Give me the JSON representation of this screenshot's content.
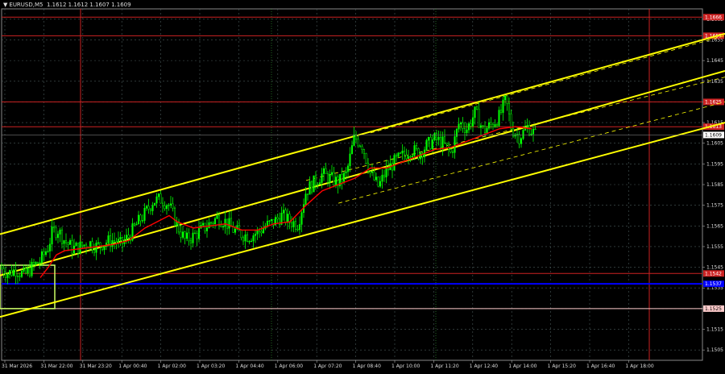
{
  "header": {
    "symbol": "EURUSD,M5",
    "ohlc": "1.1612 1.1612 1.1607 1.1609"
  },
  "chart_data": {
    "type": "candlestick",
    "symbol": "EURUSD",
    "timeframe": "M5",
    "ylim": [
      1.15,
      1.167
    ],
    "y_ticks": [
      "1.1665",
      "1.1655",
      "1.1645",
      "1.1635",
      "1.1625",
      "1.1615",
      "1.1605",
      "1.1595",
      "1.1585",
      "1.1575",
      "1.1565",
      "1.1555",
      "1.1545",
      "1.1535",
      "1.1525",
      "1.1515",
      "1.1505"
    ],
    "x_ticks": [
      "31 Mar 2026",
      "31 Mar 22:00",
      "31 Mar 23:20",
      "1 Apr 00:40",
      "1 Apr 02:00",
      "1 Apr 03:20",
      "1 Apr 04:40",
      "1 Apr 06:00",
      "1 Apr 07:20",
      "1 Apr 08:40",
      "1 Apr 10:00",
      "1 Apr 11:20",
      "1 Apr 12:40",
      "1 Apr 14:00",
      "1 Apr 15:20",
      "1 Apr 16:40",
      "1 Apr 18:00"
    ],
    "price_series": [
      [
        0,
        1.1545
      ],
      [
        10,
        1.1542
      ],
      [
        20,
        1.1544
      ],
      [
        30,
        1.1541
      ],
      [
        40,
        1.1545
      ],
      [
        50,
        1.1548
      ],
      [
        60,
        1.1555
      ],
      [
        65,
        1.1562
      ],
      [
        72,
        1.1563
      ],
      [
        80,
        1.1558
      ],
      [
        90,
        1.1554
      ],
      [
        100,
        1.1555
      ],
      [
        110,
        1.1557
      ],
      [
        120,
        1.1555
      ],
      [
        130,
        1.1557
      ],
      [
        140,
        1.1558
      ],
      [
        150,
        1.1556
      ],
      [
        160,
        1.156
      ],
      [
        170,
        1.1566
      ],
      [
        180,
        1.1571
      ],
      [
        190,
        1.1577
      ],
      [
        200,
        1.1578
      ],
      [
        210,
        1.1575
      ],
      [
        220,
        1.1565
      ],
      [
        230,
        1.1558
      ],
      [
        240,
        1.156
      ],
      [
        250,
        1.1563
      ],
      [
        260,
        1.1566
      ],
      [
        270,
        1.1569
      ],
      [
        280,
        1.1567
      ],
      [
        290,
        1.1563
      ],
      [
        300,
        1.1561
      ],
      [
        310,
        1.156
      ],
      [
        320,
        1.1562
      ],
      [
        330,
        1.1565
      ],
      [
        340,
        1.1567
      ],
      [
        350,
        1.157
      ],
      [
        360,
        1.1567
      ],
      [
        370,
        1.1566
      ],
      [
        380,
        1.1582
      ],
      [
        390,
        1.1586
      ],
      [
        400,
        1.159
      ],
      [
        410,
        1.1588
      ],
      [
        420,
        1.1586
      ],
      [
        430,
        1.159
      ],
      [
        440,
        1.1608
      ],
      [
        450,
        1.1604
      ],
      [
        460,
        1.159
      ],
      [
        470,
        1.1584
      ],
      [
        480,
        1.1592
      ],
      [
        490,
        1.1596
      ],
      [
        500,
        1.1599
      ],
      [
        510,
        1.1602
      ],
      [
        520,
        1.16
      ],
      [
        530,
        1.1604
      ],
      [
        540,
        1.1607
      ],
      [
        550,
        1.1605
      ],
      [
        560,
        1.16
      ],
      [
        570,
        1.1615
      ],
      [
        580,
        1.1612
      ],
      [
        590,
        1.162
      ],
      [
        600,
        1.1611
      ],
      [
        610,
        1.1614
      ],
      [
        620,
        1.1618
      ],
      [
        628,
        1.1626
      ],
      [
        635,
        1.1612
      ],
      [
        645,
        1.1608
      ],
      [
        655,
        1.1613
      ],
      [
        665,
        1.1609
      ]
    ],
    "ma_series": [
      [
        50,
        1.154
      ],
      [
        60,
        1.1545
      ],
      [
        70,
        1.1551
      ],
      [
        80,
        1.1553
      ],
      [
        100,
        1.1554
      ],
      [
        120,
        1.1555
      ],
      [
        140,
        1.1556
      ],
      [
        160,
        1.1558
      ],
      [
        180,
        1.1564
      ],
      [
        200,
        1.1568
      ],
      [
        210,
        1.157
      ],
      [
        220,
        1.1567
      ],
      [
        240,
        1.1564
      ],
      [
        260,
        1.1565
      ],
      [
        280,
        1.1566
      ],
      [
        300,
        1.1563
      ],
      [
        320,
        1.1563
      ],
      [
        340,
        1.1566
      ],
      [
        360,
        1.1567
      ],
      [
        380,
        1.1575
      ],
      [
        400,
        1.1582
      ],
      [
        420,
        1.1585
      ],
      [
        440,
        1.1588
      ],
      [
        460,
        1.1593
      ],
      [
        480,
        1.1593
      ],
      [
        500,
        1.1596
      ],
      [
        520,
        1.1599
      ],
      [
        540,
        1.1602
      ],
      [
        560,
        1.1603
      ],
      [
        580,
        1.1606
      ],
      [
        600,
        1.1609
      ],
      [
        620,
        1.1612
      ],
      [
        640,
        1.1613
      ],
      [
        660,
        1.1612
      ]
    ],
    "horizontal_levels": [
      {
        "price": "1.1666",
        "label": "1.1666",
        "color": "#cc2222"
      },
      {
        "price": "1.1657",
        "label": "1.1657",
        "color": "#cc2222"
      },
      {
        "price": "1.1625",
        "label": "1.1625",
        "color": "#cc2222"
      },
      {
        "price": "1.1613",
        "label": "1.1613",
        "color": "#cc2222"
      },
      {
        "price": "1.1542",
        "label": "1.1542",
        "color": "#cc2222"
      },
      {
        "price": "1.1537",
        "label": "1.1537",
        "color": "#0000ff"
      },
      {
        "price": "1.1525",
        "label": "1.1525",
        "color": "#ffcccc"
      }
    ],
    "current_price": "1.1609",
    "vertical_lines": [
      {
        "x_index": 100,
        "color": "#cc2222"
      },
      {
        "x_index": 806,
        "color": "#cc2222"
      }
    ],
    "channel_lines": [
      {
        "from": [
          0,
          1.1561
        ],
        "to": [
          900,
          1.1658
        ],
        "style": "solid"
      },
      {
        "from": [
          0,
          1.1541
        ],
        "to": [
          900,
          1.164
        ],
        "style": "solid"
      },
      {
        "from": [
          0,
          1.1521
        ],
        "to": [
          900,
          1.1615
        ],
        "style": "solid"
      },
      {
        "from": [
          380,
          1.1587
        ],
        "to": [
          900,
          1.1637
        ],
        "style": "dashed"
      },
      {
        "from": [
          420,
          1.1576
        ],
        "to": [
          900,
          1.1625
        ],
        "style": "dashed"
      },
      {
        "from": [
          460,
          1.161
        ],
        "to": [
          900,
          1.1657
        ],
        "style": "dashed"
      }
    ],
    "rectangle": {
      "x_start_index": 0,
      "x_end_index": 68,
      "y_top": 1.1546,
      "y_bottom": 1.1525,
      "color": "#ccff66"
    },
    "colors": {
      "background": "#000000",
      "bull": "#00ff00",
      "ma": "#ff0000",
      "channel": "#ffff00",
      "grid": "#4a5a5a"
    }
  }
}
